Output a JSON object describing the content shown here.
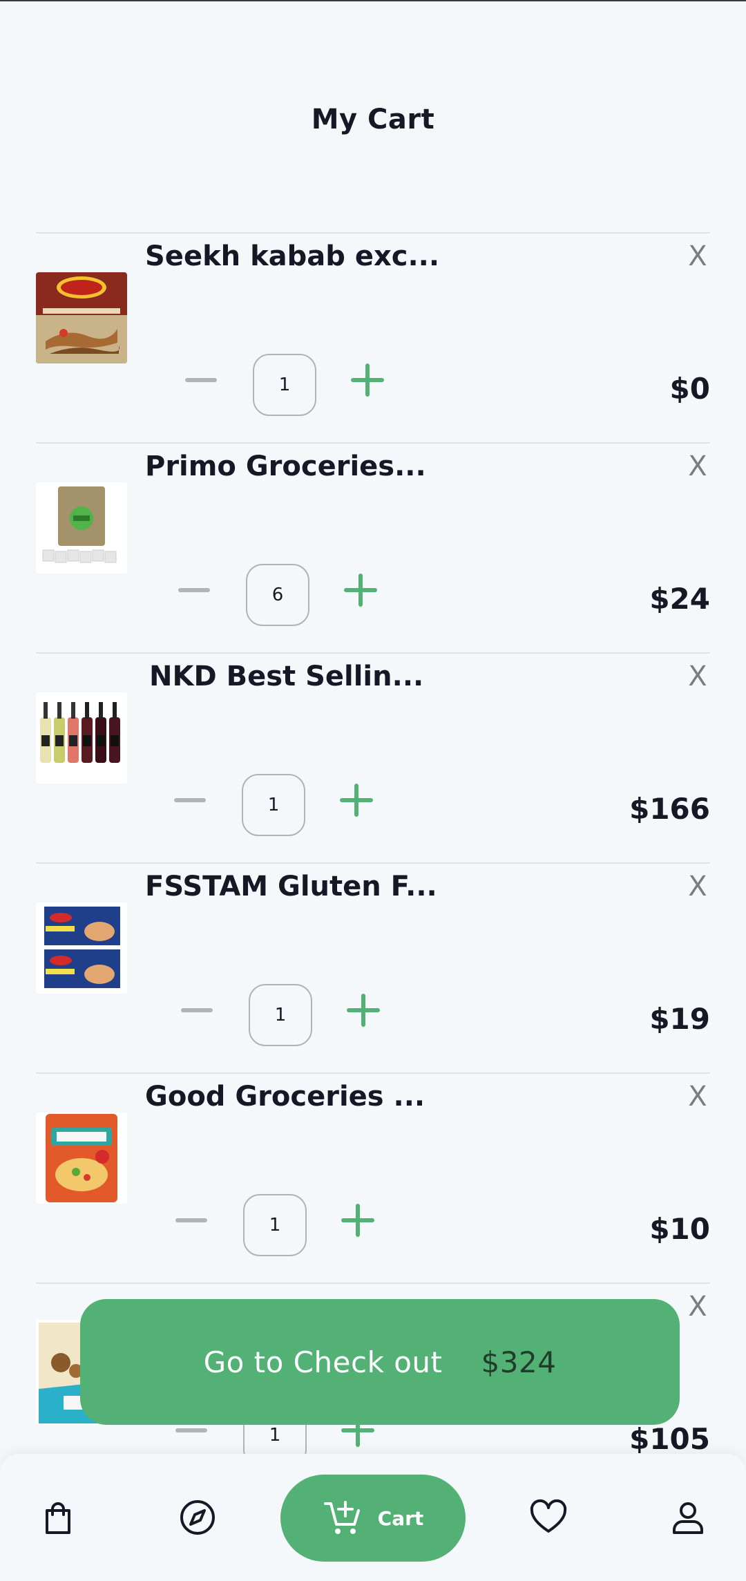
{
  "header": {
    "title": "My Cart"
  },
  "cart": {
    "remove_label": "X",
    "items": [
      {
        "name": "Seekh kabab exc...",
        "quantity": "1",
        "price": "$0",
        "image": "seekh-kabab-box"
      },
      {
        "name": "Primo Groceries...",
        "quantity": "6",
        "price": "$24",
        "image": "tea-pouch"
      },
      {
        "name": "NKD Best Sellin...",
        "quantity": "1",
        "price": "$166",
        "image": "wine-bottles"
      },
      {
        "name": "FSSTAM Gluten F...",
        "quantity": "1",
        "price": "$19",
        "image": "lasagne-boxes"
      },
      {
        "name": "Good Groceries ...",
        "quantity": "1",
        "price": "$10",
        "image": "quinoa-bag"
      },
      {
        "name": "",
        "quantity": "1",
        "price": "$105",
        "image": "snack-box"
      }
    ]
  },
  "checkout": {
    "label": "Go to Check out",
    "total": "$324"
  },
  "bottom_nav": {
    "items": [
      {
        "icon": "shopping-bag-icon"
      },
      {
        "icon": "compass-icon"
      },
      {
        "icon": "cart-add-icon",
        "label": "Cart",
        "active": true
      },
      {
        "icon": "heart-icon"
      },
      {
        "icon": "user-icon"
      }
    ]
  },
  "colors": {
    "accent": "#53b175",
    "background": "#f5f8fa",
    "text": "#181725",
    "muted": "#7c7c7c"
  }
}
